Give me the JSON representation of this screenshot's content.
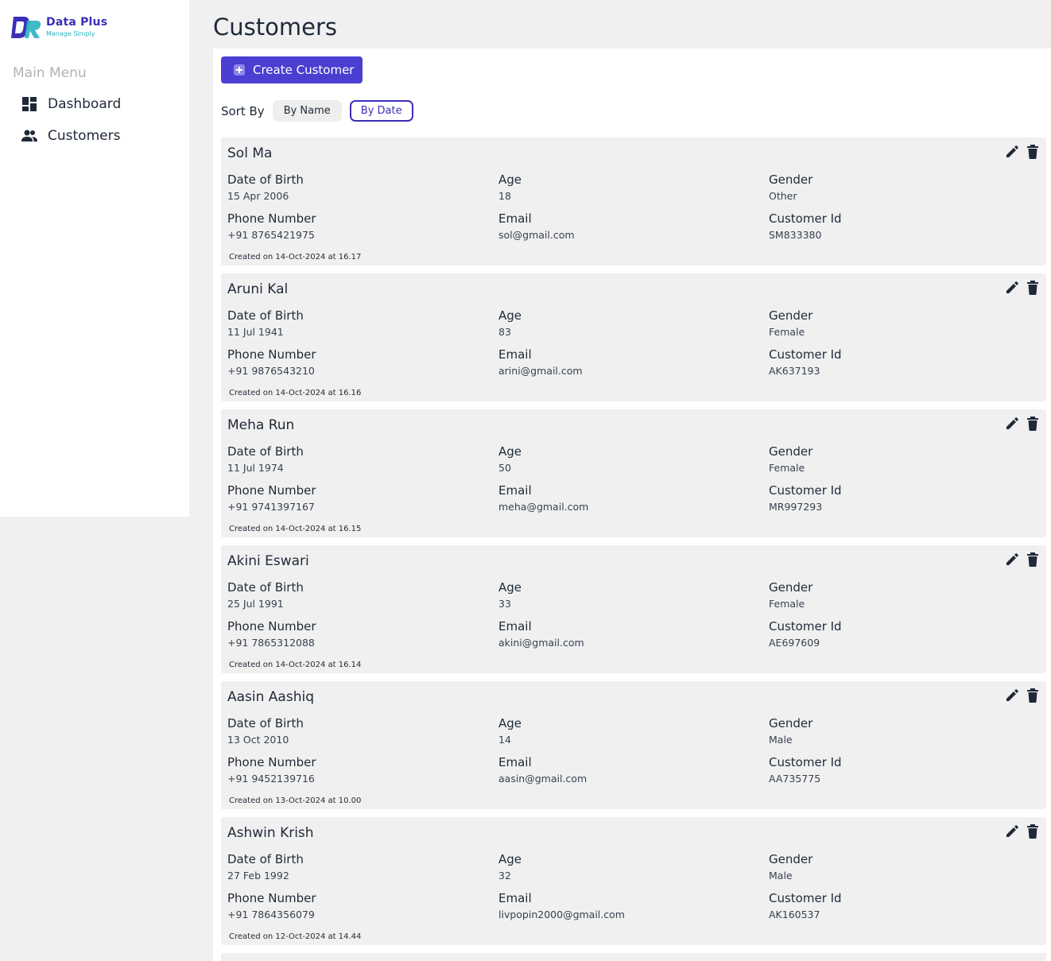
{
  "app": {
    "title": "Data Plus",
    "subtitle": "Manage Simply",
    "brand_color": "#4a3fd1"
  },
  "sidebar": {
    "menu_title": "Main Menu",
    "items": [
      {
        "label": "Dashboard",
        "icon": "dashboard-icon"
      },
      {
        "label": "Customers",
        "icon": "people-icon"
      }
    ]
  },
  "main": {
    "page_title": "Customers",
    "create_label": "Create Customer",
    "sort_label": "Sort By",
    "sort_options": [
      "By Name",
      "By Date"
    ],
    "active_sort": "By Date"
  },
  "labels": {
    "dob": "Date of Birth",
    "age": "Age",
    "gender": "Gender",
    "phone": "Phone Number",
    "email": "Email",
    "customer_id": "Customer Id"
  },
  "customers": [
    {
      "name": "Sol Ma",
      "dob": "15 Apr 2006",
      "age": "18",
      "gender": "Other",
      "phone": "+91 8765421975",
      "email": "sol@gmail.com",
      "customer_id": "SM833380",
      "created": "Created on 14-Oct-2024 at 16.17"
    },
    {
      "name": "Aruni Kal",
      "dob": "11 Jul 1941",
      "age": "83",
      "gender": "Female",
      "phone": "+91 9876543210",
      "email": "arini@gmail.com",
      "customer_id": "AK637193",
      "created": "Created on 14-Oct-2024 at 16.16"
    },
    {
      "name": "Meha Run",
      "dob": "11 Jul 1974",
      "age": "50",
      "gender": "Female",
      "phone": "+91 9741397167",
      "email": "meha@gmail.com",
      "customer_id": "MR997293",
      "created": "Created on 14-Oct-2024 at 16.15"
    },
    {
      "name": "Akini Eswari",
      "dob": "25 Jul 1991",
      "age": "33",
      "gender": "Female",
      "phone": "+91 7865312088",
      "email": "akini@gmail.com",
      "customer_id": "AE697609",
      "created": "Created on 14-Oct-2024 at 16.14"
    },
    {
      "name": "Aasin Aashiq",
      "dob": "13 Oct 2010",
      "age": "14",
      "gender": "Male",
      "phone": "+91 9452139716",
      "email": "aasin@gmail.com",
      "customer_id": "AA735775",
      "created": "Created on 13-Oct-2024 at 10.00"
    },
    {
      "name": "Ashwin Krish",
      "dob": "27 Feb 1992",
      "age": "32",
      "gender": "Male",
      "phone": "+91 7864356079",
      "email": "livpopin2000@gmail.com",
      "customer_id": "AK160537",
      "created": "Created on 12-Oct-2024 at 14.44"
    }
  ]
}
